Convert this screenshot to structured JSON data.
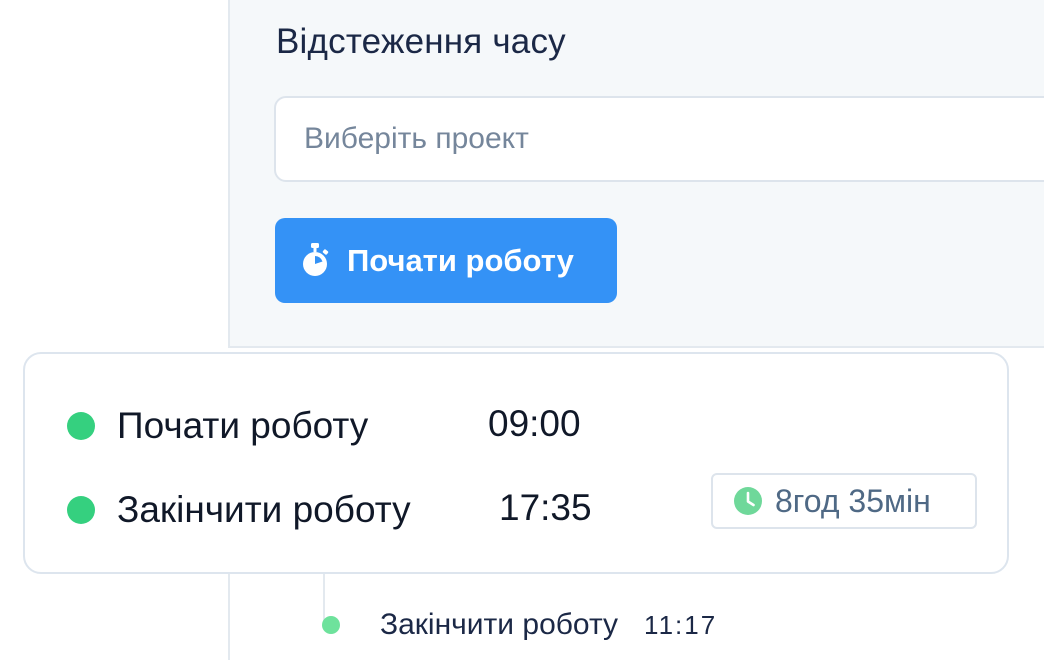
{
  "tracker": {
    "title": "Відстеження часу",
    "project_placeholder": "Виберіть проект",
    "start_button": {
      "label": "Почати роботу",
      "icon": "stopwatch-icon",
      "color": "#3492f6"
    }
  },
  "summary_card": {
    "rows": [
      {
        "label": "Почати роботу",
        "time": "09:00",
        "status_color": "#35d07f"
      },
      {
        "label": "Закінчити роботу",
        "time": "17:35",
        "status_color": "#35d07f"
      }
    ],
    "duration": {
      "icon": "clock-icon",
      "text": "8год 35мін"
    }
  },
  "timeline": {
    "entries": [
      {
        "label": "Закінчити роботу",
        "time": "11:17",
        "status_color": "#6ee29c"
      }
    ]
  }
}
